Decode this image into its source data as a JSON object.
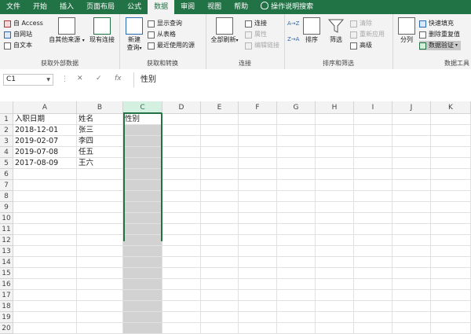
{
  "tabs": [
    "文件",
    "开始",
    "插入",
    "页面布局",
    "公式",
    "数据",
    "审阅",
    "视图",
    "帮助",
    "操作说明搜索"
  ],
  "active_tab": "数据",
  "ribbon": {
    "get_external": {
      "items": [
        "自 Access",
        "自网站",
        "自文本"
      ],
      "other_sources": "自其他来源",
      "existing_conn": "现有连接",
      "label": "获取外部数据"
    },
    "get_transform": {
      "new_query": "新建\n查询",
      "items": [
        "显示查询",
        "从表格",
        "最近使用的源"
      ],
      "label": "获取和转换"
    },
    "connections": {
      "refresh_all": "全部刷新",
      "items": [
        "连接",
        "属性",
        "编辑链接"
      ],
      "label": "连接"
    },
    "sort_filter": {
      "sort_asc": "A→Z",
      "sort_desc": "Z→A",
      "sort": "排序",
      "filter": "筛选",
      "items": [
        "清除",
        "重新应用",
        "高级"
      ],
      "label": "排序和筛选"
    },
    "data_tools": {
      "split": "分列",
      "items": [
        "快速填充",
        "删除重复值",
        "数据验证"
      ],
      "label": "数据工具"
    }
  },
  "formula_bar": {
    "name_box": "C1",
    "cancel": "✕",
    "enter": "✓",
    "fx": "fx",
    "content": "性别"
  },
  "grid": {
    "columns": [
      "A",
      "B",
      "C",
      "D",
      "E",
      "F",
      "G",
      "H",
      "I",
      "J",
      "K"
    ],
    "rows": [
      "1",
      "2",
      "3",
      "4",
      "5",
      "6",
      "7",
      "8",
      "9",
      "10",
      "11",
      "12",
      "13",
      "14",
      "15",
      "16",
      "17",
      "18",
      "19",
      "20"
    ],
    "cells": {
      "A1": "入职日期",
      "B1": "姓名",
      "C1": "性别",
      "A2": "2018-12-01",
      "B2": "张三",
      "A3": "2019-02-07",
      "B3": "李四",
      "A4": "2019-07-08",
      "B4": "任五",
      "A5": "2017-08-09",
      "B5": "王六"
    }
  },
  "colors": {
    "accent": "#217346",
    "selection": "#d2d2d2"
  }
}
